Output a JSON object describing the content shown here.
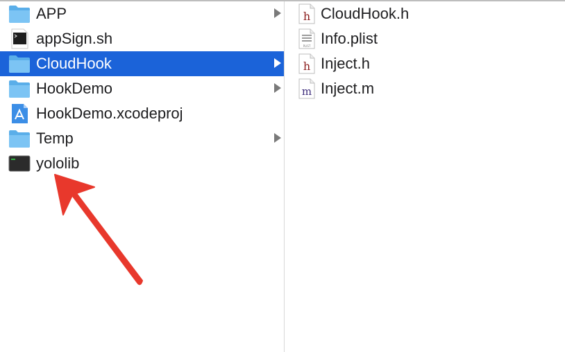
{
  "left_column": {
    "items": [
      {
        "label": "APP",
        "icon": "folder-icon"
      },
      {
        "label": "appSign.sh",
        "icon": "terminal-script-icon"
      },
      {
        "label": "CloudHook",
        "icon": "folder-icon",
        "selected": true
      },
      {
        "label": "HookDemo",
        "icon": "folder-icon"
      },
      {
        "label": "HookDemo.xcodeproj",
        "icon": "xcode-project-icon"
      },
      {
        "label": "Temp",
        "icon": "folder-icon"
      },
      {
        "label": "yololib",
        "icon": "unix-executable-icon"
      }
    ]
  },
  "right_column": {
    "items": [
      {
        "label": "CloudHook.h",
        "icon": "header-file-icon",
        "glyph": "h"
      },
      {
        "label": "Info.plist",
        "icon": "plist-file-icon",
        "glyph": "PLIST"
      },
      {
        "label": "Inject.h",
        "icon": "header-file-icon",
        "glyph": "h"
      },
      {
        "label": "Inject.m",
        "icon": "objc-source-file-icon",
        "glyph": "m"
      }
    ]
  },
  "colors": {
    "selection": "#1b63d9",
    "folder": "#60b3ec",
    "annotation_arrow": "#e8382c"
  }
}
